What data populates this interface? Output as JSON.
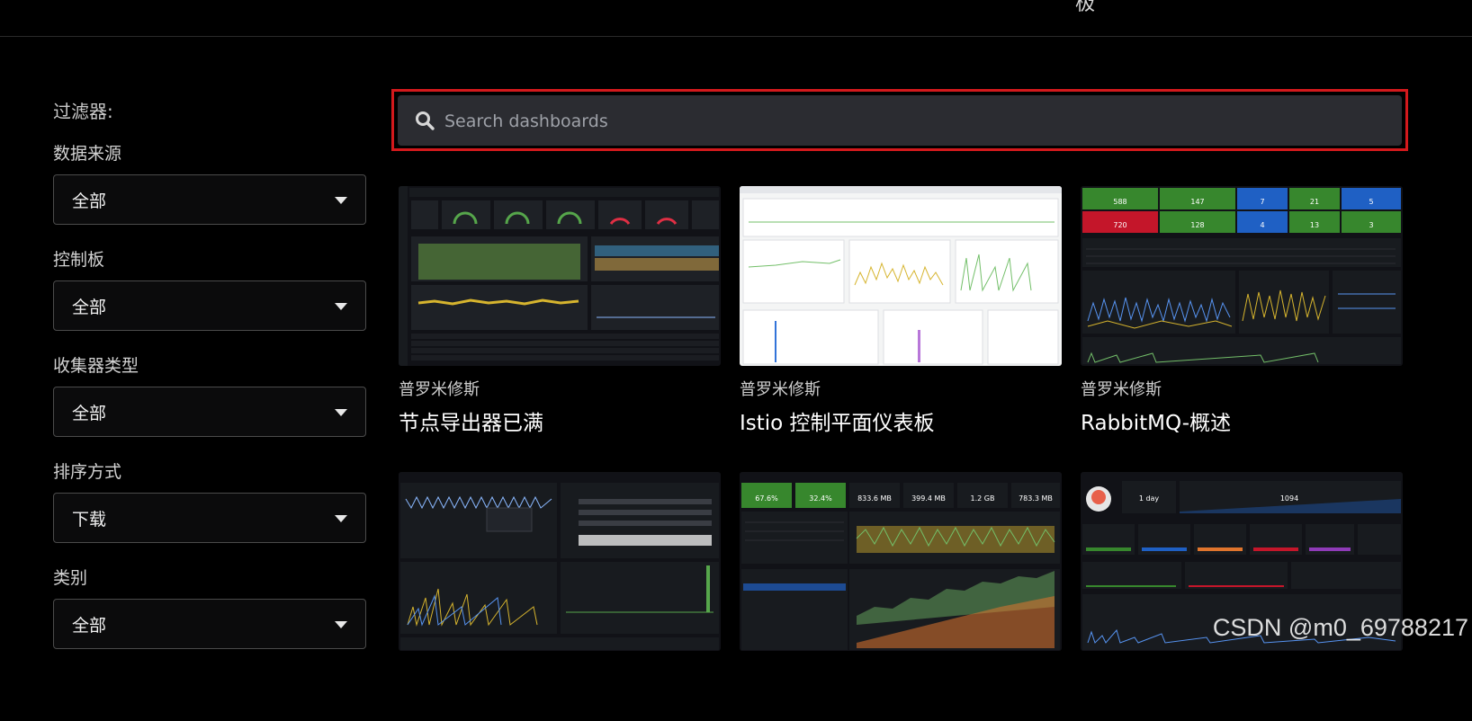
{
  "top_partial_text": "极",
  "filters": {
    "title": "过滤器:",
    "groups": [
      {
        "label": "数据来源",
        "value": "全部"
      },
      {
        "label": "控制板",
        "value": "全部"
      },
      {
        "label": "收集器类型",
        "value": "全部"
      },
      {
        "label": "排序方式",
        "value": "下载"
      },
      {
        "label": "类别",
        "value": "全部"
      }
    ]
  },
  "search": {
    "placeholder": "Search dashboards"
  },
  "cards": [
    {
      "source": "普罗米修斯",
      "name": "节点导出器已满"
    },
    {
      "source": "普罗米修斯",
      "name": "Istio 控制平面仪表板"
    },
    {
      "source": "普罗米修斯",
      "name": "RabbitMQ-概述"
    },
    {
      "source": "",
      "name": ""
    },
    {
      "source": "",
      "name": ""
    },
    {
      "source": "",
      "name": ""
    }
  ],
  "thumb_labels": {
    "rabbit": {
      "stats": [
        "588",
        "147",
        "7",
        "21",
        "5",
        "720",
        "128",
        "4",
        "13",
        "3"
      ]
    },
    "istio": {
      "stats": [
        "67.6%",
        "32.4%",
        "833.6 MB",
        "399.4 MB",
        "1.2 GB",
        "783.3 MB"
      ]
    },
    "apps": {
      "stats": [
        "1 day",
        "1094"
      ]
    }
  },
  "watermark": "CSDN @m0_69788217",
  "colors": {
    "highlight_border": "#d3191c",
    "search_bg": "#2b2c31",
    "panel_dark": "#181b1f",
    "green": "#37872d",
    "red": "#c4162a",
    "blue": "#1f60c4"
  }
}
